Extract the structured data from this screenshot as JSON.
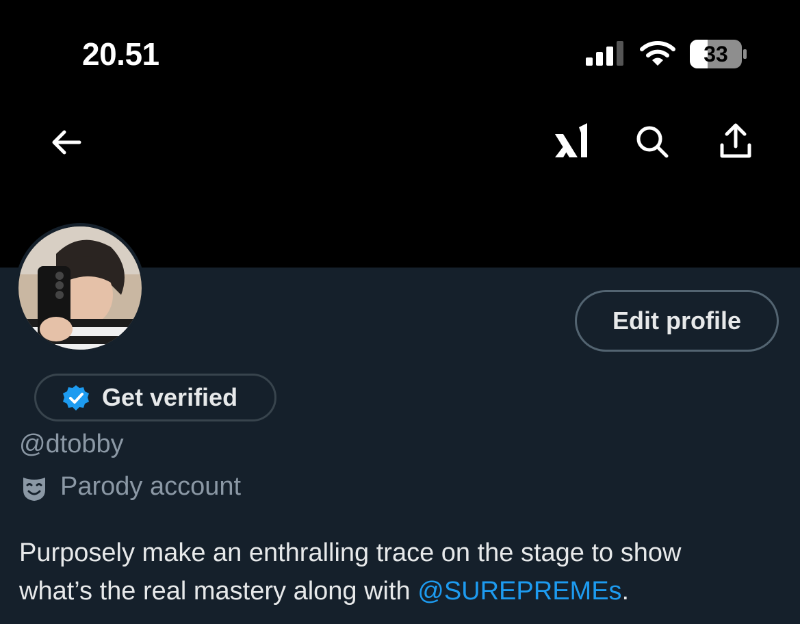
{
  "status_bar": {
    "time": "20.51",
    "battery_level": "33",
    "icons": [
      "signal-bars-icon",
      "wifi-icon",
      "battery-icon"
    ]
  },
  "nav": {
    "icons": [
      "back-arrow-icon",
      "grok-icon",
      "search-icon",
      "share-icon"
    ]
  },
  "profile": {
    "edit_button_label": "Edit profile",
    "get_verified_label": "Get verified",
    "handle": "@dtobby",
    "parody_label": "Parody account",
    "bio": {
      "text_line1": "Purposely make an enthralling trace on the stage to show",
      "text_line2_before": "what’s the real mastery along with ",
      "mention": "@SUREPREMEs",
      "text_after": "."
    }
  },
  "colors": {
    "background": "#15202b",
    "header": "#000000",
    "accent_blue": "#1d9bf0",
    "muted_text": "#8b98a5",
    "button_border": "#536471"
  }
}
